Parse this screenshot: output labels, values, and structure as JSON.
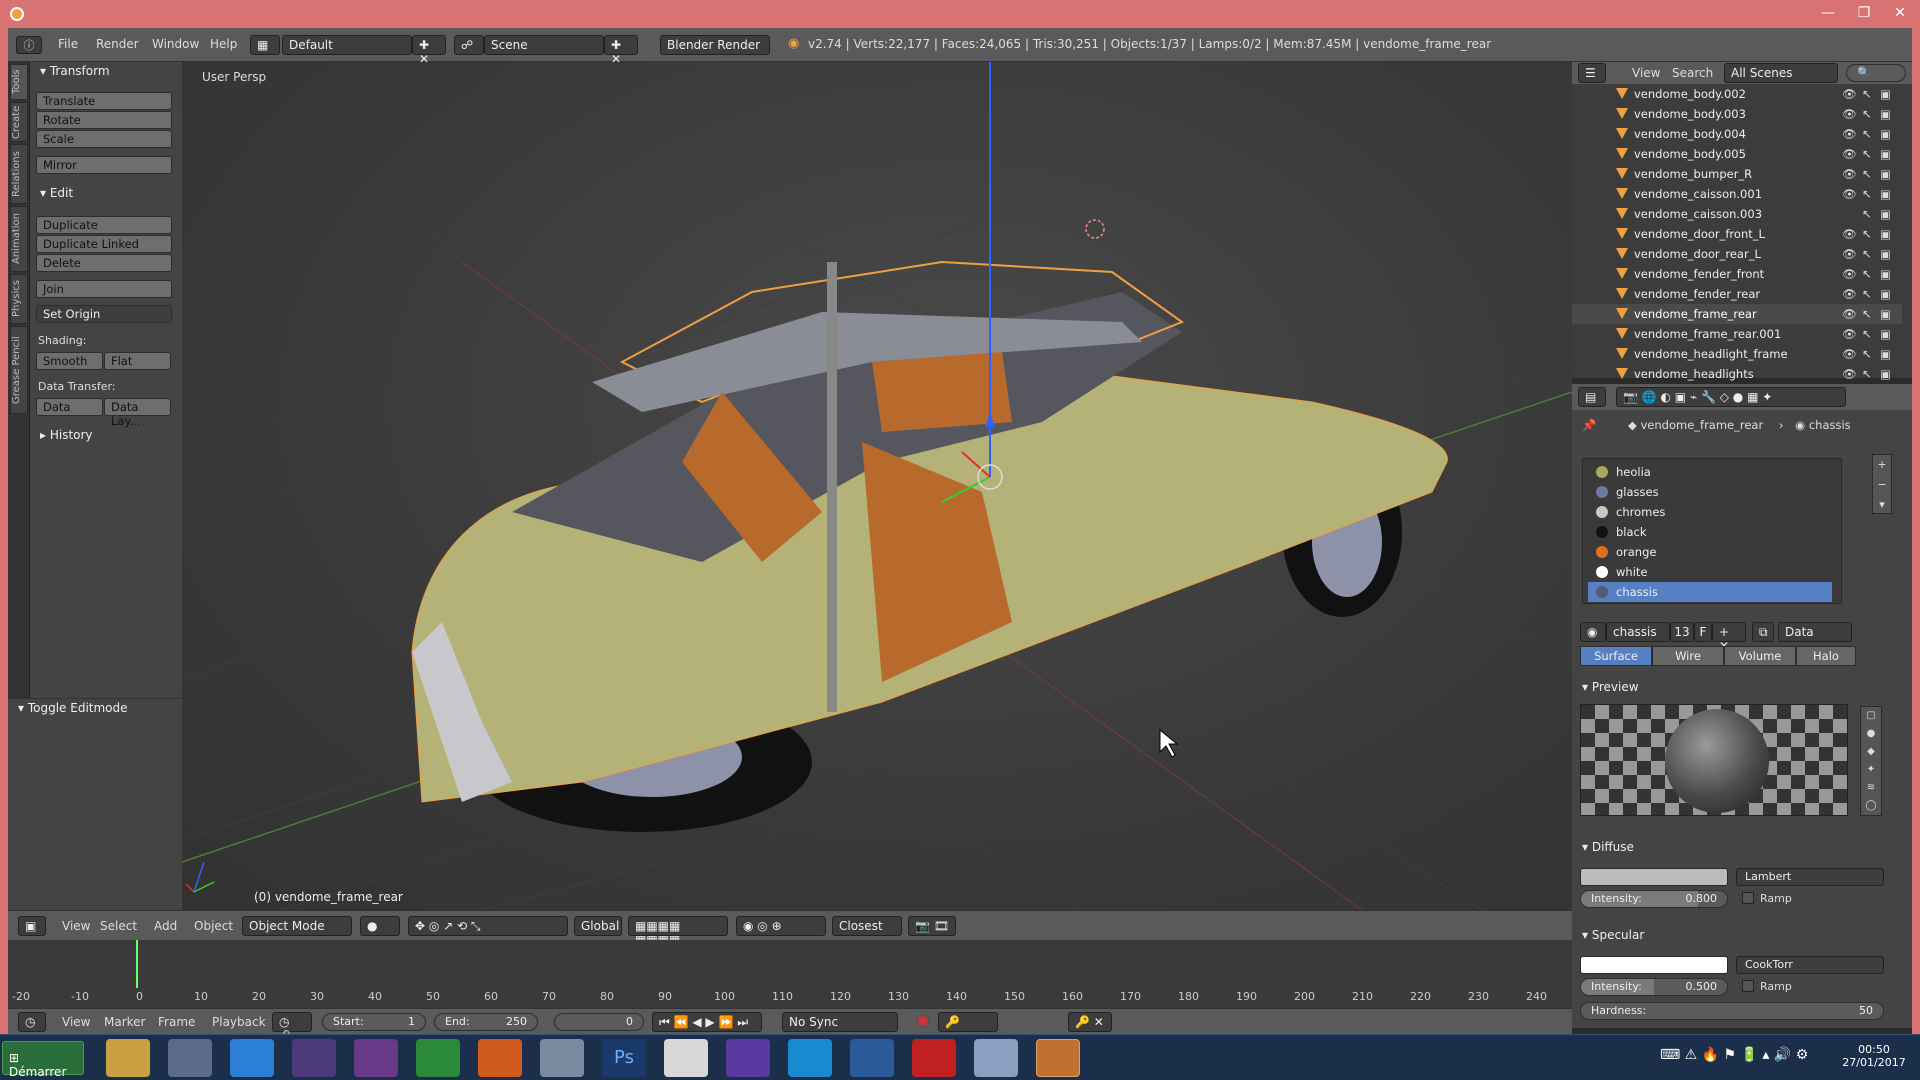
{
  "window": {
    "title_controls": [
      "—",
      "❐",
      "✕"
    ]
  },
  "infobar": {
    "menus": [
      "File",
      "Render",
      "Window",
      "Help"
    ],
    "layout": "Default",
    "scene": "Scene",
    "engine": "Blender Render",
    "stats": "v2.74 | Verts:22,177 | Faces:24,065 | Tris:30,251 | Objects:1/37 | Lamps:0/2 | Mem:87.45M | vendome_frame_rear"
  },
  "vtabs": [
    "Tools",
    "Create",
    "Relations",
    "Animation",
    "Physics",
    "Grease Pencil"
  ],
  "toolshelf": {
    "transform_title": "Transform",
    "translate": "Translate",
    "rotate": "Rotate",
    "scale": "Scale",
    "mirror": "Mirror",
    "edit_title": "Edit",
    "duplicate": "Duplicate",
    "duplicate_linked": "Duplicate Linked",
    "delete": "Delete",
    "join": "Join",
    "set_origin": "Set Origin",
    "shading_label": "Shading:",
    "smooth": "Smooth",
    "flat": "Flat",
    "data_transfer_label": "Data Transfer:",
    "data": "Data",
    "data_layout": "Data Lay...",
    "history": "History",
    "toggle_editmode": "Toggle Editmode"
  },
  "viewport": {
    "label": "User Persp",
    "active_object": "(0) vendome_frame_rear"
  },
  "header3d": {
    "menus": [
      "View",
      "Select",
      "Add",
      "Object"
    ],
    "mode": "Object Mode",
    "orientation": "Global",
    "snap": "Closest"
  },
  "timeline": {
    "ticks": [
      "-20",
      "-10",
      "0",
      "10",
      "20",
      "30",
      "40",
      "50",
      "60",
      "70",
      "80",
      "90",
      "100",
      "110",
      "120",
      "130",
      "140",
      "150",
      "160",
      "170",
      "180",
      "190",
      "200",
      "210",
      "220",
      "230",
      "240"
    ],
    "menus": [
      "View",
      "Marker",
      "Frame",
      "Playback"
    ],
    "start_label": "Start:",
    "start": "1",
    "end_label": "End:",
    "end": "250",
    "current": "0",
    "sync": "No Sync"
  },
  "outliner": {
    "menus": [
      "View",
      "Search"
    ],
    "filter": "All Scenes",
    "rows": [
      {
        "name": "vendome_body.002"
      },
      {
        "name": "vendome_body.003"
      },
      {
        "name": "vendome_body.004"
      },
      {
        "name": "vendome_body.005"
      },
      {
        "name": "vendome_bumper_R"
      },
      {
        "name": "vendome_caisson.001"
      },
      {
        "name": "vendome_caisson.003"
      },
      {
        "name": "vendome_door_front_L"
      },
      {
        "name": "vendome_door_rear_L"
      },
      {
        "name": "vendome_fender_front"
      },
      {
        "name": "vendome_fender_rear"
      },
      {
        "name": "vendome_frame_rear"
      },
      {
        "name": "vendome_frame_rear.001"
      },
      {
        "name": "vendome_headlight_frame"
      },
      {
        "name": "vendome_headlights"
      }
    ]
  },
  "properties": {
    "breadcrumb_object": "vendome_frame_rear",
    "breadcrumb_material": "chassis",
    "slots": [
      {
        "name": "heolia",
        "color": "#a8a860"
      },
      {
        "name": "glasses",
        "color": "#6a7aa0"
      },
      {
        "name": "chromes",
        "color": "#c8c8c8"
      },
      {
        "name": "black",
        "color": "#111111"
      },
      {
        "name": "orange",
        "color": "#e07020"
      },
      {
        "name": "white",
        "color": "#ffffff"
      },
      {
        "name": "chassis",
        "color": "#505a70"
      }
    ],
    "material_name": "chassis",
    "users": "13",
    "fake": "F",
    "link": "Data",
    "tabs": [
      "Surface",
      "Wire",
      "Volume",
      "Halo"
    ],
    "preview_title": "Preview",
    "diffuse_title": "Diffuse",
    "diffuse_shader": "Lambert",
    "diffuse_intensity_label": "Intensity:",
    "diffuse_intensity": "0.800",
    "ramp": "Ramp",
    "specular_title": "Specular",
    "specular_shader": "CookTorr",
    "specular_intensity_label": "Intensity:",
    "specular_intensity": "0.500",
    "hardness_label": "Hardness:",
    "hardness": "50"
  },
  "taskbar": {
    "start": "Démarrer",
    "time": "00:50",
    "date": "27/01/2017"
  },
  "colors": {
    "accent": "#5680c2",
    "selection_orange": "#f0a040",
    "titlebar": "#d97373"
  }
}
